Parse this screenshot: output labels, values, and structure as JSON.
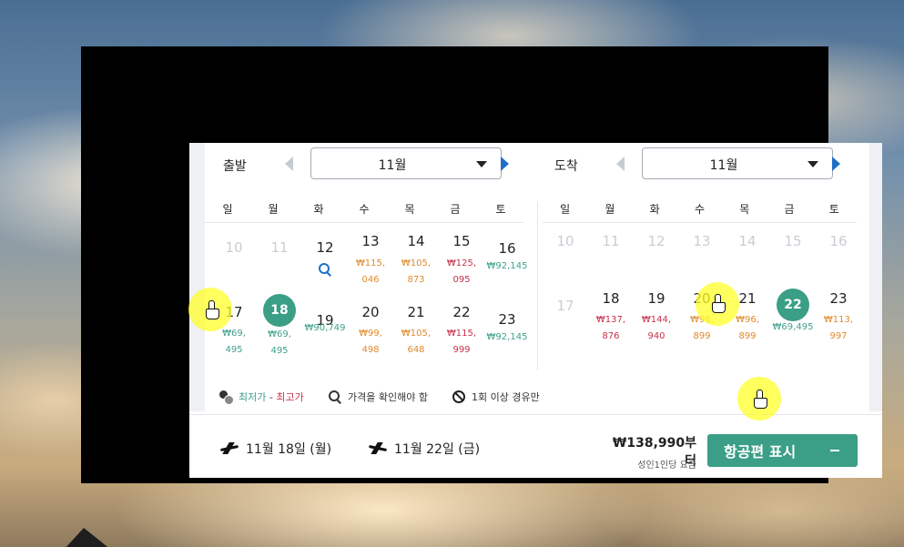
{
  "departure": {
    "label": "출발",
    "month": "11월",
    "weekdays": [
      "일",
      "월",
      "화",
      "수",
      "목",
      "금",
      "토"
    ],
    "days": {
      "d10": {
        "num": "10"
      },
      "d11": {
        "num": "11"
      },
      "d12": {
        "num": "12"
      },
      "d13": {
        "num": "13",
        "price": "₩115,\n046"
      },
      "d14": {
        "num": "14",
        "price": "₩105,\n873"
      },
      "d15": {
        "num": "15",
        "price": "₩125,\n095"
      },
      "d16": {
        "num": "16",
        "price": "₩92,145"
      },
      "d17": {
        "num": "17",
        "price": "₩69,\n495"
      },
      "d18": {
        "num": "18",
        "price": "₩69,\n495"
      },
      "d19": {
        "num": "19",
        "price": "₩90,749"
      },
      "d20": {
        "num": "20",
        "price": "₩99,\n498"
      },
      "d21": {
        "num": "21",
        "price": "₩105,\n648"
      },
      "d22": {
        "num": "22",
        "price": "₩115,\n999"
      },
      "d23": {
        "num": "23",
        "price": "₩92,145"
      }
    }
  },
  "return": {
    "label": "도착",
    "month": "11월",
    "weekdays": [
      "일",
      "월",
      "화",
      "수",
      "목",
      "금",
      "토"
    ],
    "days": {
      "d10": {
        "num": "10"
      },
      "d11": {
        "num": "11"
      },
      "d12": {
        "num": "12"
      },
      "d13": {
        "num": "13"
      },
      "d14": {
        "num": "14"
      },
      "d15": {
        "num": "15"
      },
      "d16": {
        "num": "16"
      },
      "d17": {
        "num": "17"
      },
      "d18": {
        "num": "18",
        "price": "₩137,\n876"
      },
      "d19": {
        "num": "19",
        "price": "₩144,\n940"
      },
      "d20": {
        "num": "20",
        "price": "₩96,\n899"
      },
      "d21": {
        "num": "21",
        "price": "₩96,\n899"
      },
      "d22": {
        "num": "22",
        "price": "₩69,495"
      },
      "d23": {
        "num": "23",
        "price": "₩113,\n997"
      }
    }
  },
  "legend": {
    "lowest": "최저가",
    "separator": " - ",
    "highest": "최고가",
    "check_price": "가격을 확인해야 함",
    "stopover": "1회 이상 경유만"
  },
  "footer": {
    "outbound_date": "11월 18일 (월)",
    "inbound_date": "11월 22일 (금)",
    "price_from": "₩138,990부터",
    "price_note": "성인1인당 요금",
    "cta_label": "항공편 표시"
  },
  "colors": {
    "accent": "#3b9e86",
    "price_low": "#3fa08c",
    "price_mid": "#e08b2c",
    "price_high": "#c8314c",
    "nav_arrow": "#1e6fc7"
  }
}
